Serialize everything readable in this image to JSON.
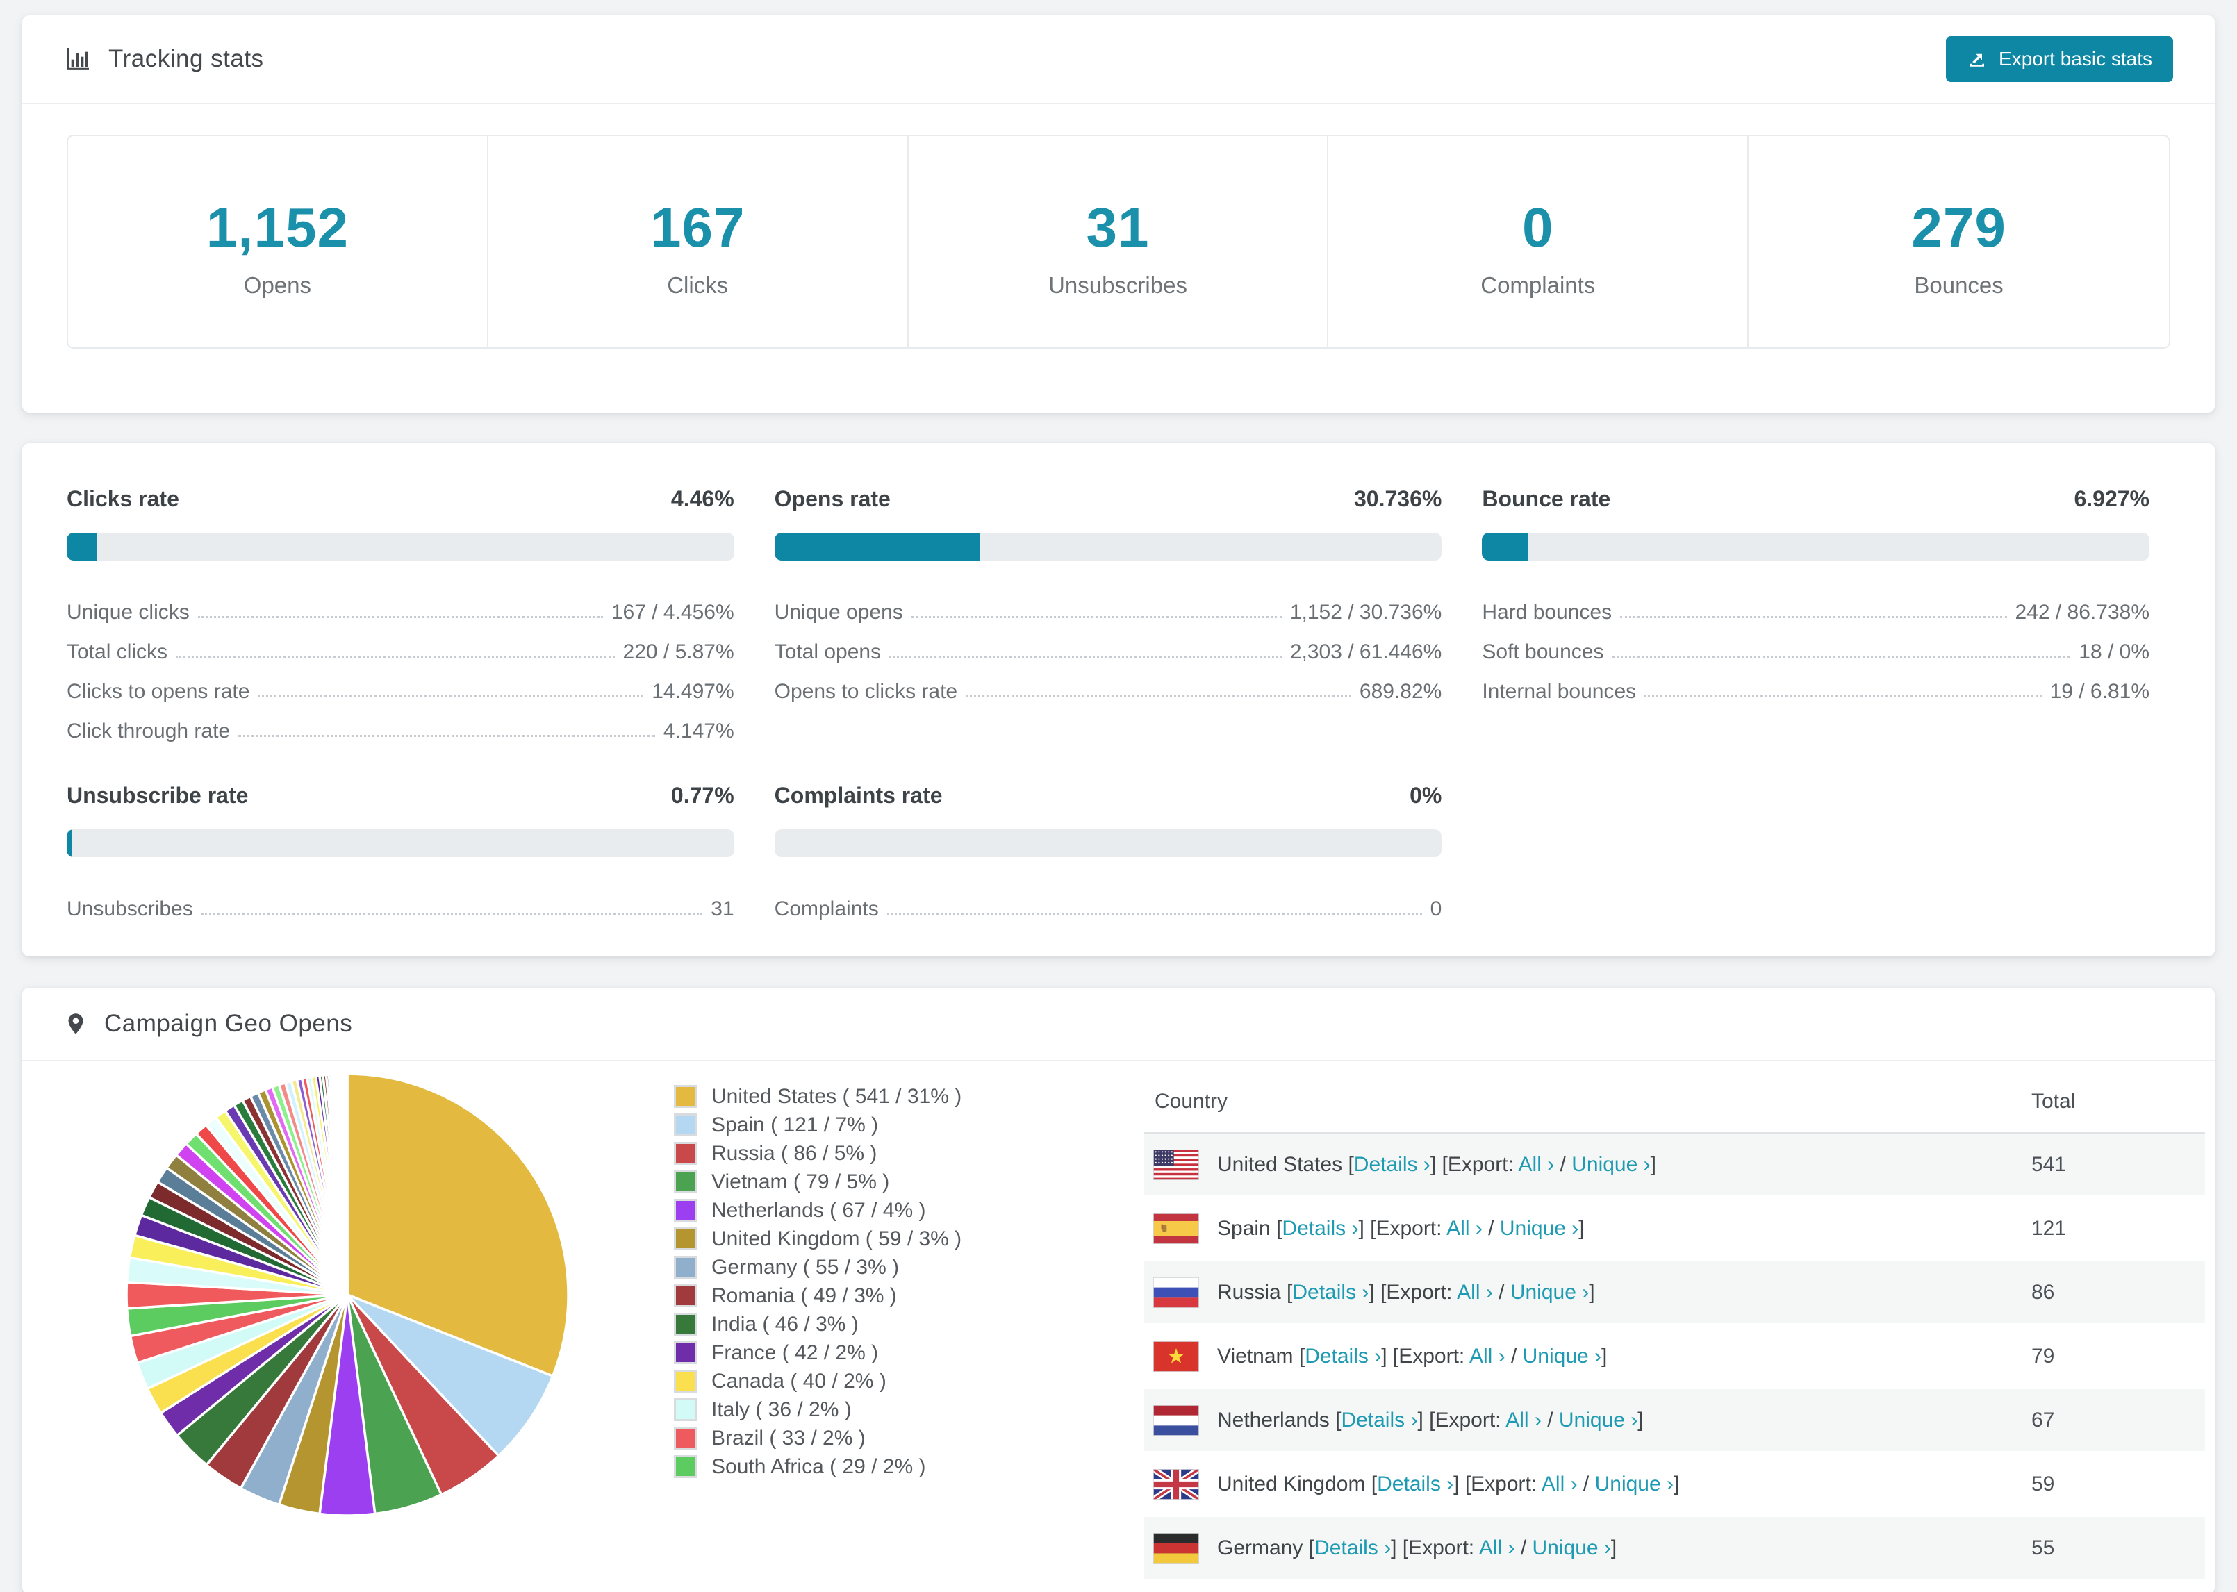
{
  "accent": {
    "teal_number": "#1b90aa",
    "teal_button": "#0d87a3",
    "teal_link": "#1e9ab2",
    "bar_track": "#e9ecef"
  },
  "tracking_card": {
    "title": "Tracking stats",
    "export_button": {
      "label": "Export basic stats"
    },
    "summary": [
      {
        "value": "1,152",
        "label": "Opens"
      },
      {
        "value": "167",
        "label": "Clicks"
      },
      {
        "value": "31",
        "label": "Unsubscribes"
      },
      {
        "value": "0",
        "label": "Complaints"
      },
      {
        "value": "279",
        "label": "Bounces"
      }
    ]
  },
  "rates_card": {
    "blocks": [
      {
        "title": "Clicks rate",
        "value": "4.46%",
        "pct": 4.46,
        "rows": [
          {
            "label": "Unique clicks",
            "value": "167 / 4.456%"
          },
          {
            "label": "Total clicks",
            "value": "220 / 5.87%"
          },
          {
            "label": "Clicks to opens rate",
            "value": "14.497%"
          },
          {
            "label": "Click through rate",
            "value": "4.147%"
          }
        ]
      },
      {
        "title": "Opens rate",
        "value": "30.736%",
        "pct": 30.736,
        "rows": [
          {
            "label": "Unique opens",
            "value": "1,152 / 30.736%"
          },
          {
            "label": "Total opens",
            "value": "2,303 / 61.446%"
          },
          {
            "label": "Opens to clicks rate",
            "value": "689.82%"
          }
        ]
      },
      {
        "title": "Bounce rate",
        "value": "6.927%",
        "pct": 6.927,
        "rows": [
          {
            "label": "Hard bounces",
            "value": "242 / 86.738%"
          },
          {
            "label": "Soft bounces",
            "value": "18 / 0%"
          },
          {
            "label": "Internal bounces",
            "value": "19 / 6.81%"
          }
        ]
      },
      {
        "title": "Unsubscribe rate",
        "value": "0.77%",
        "pct": 0.77,
        "rows": [
          {
            "label": "Unsubscribes",
            "value": "31"
          }
        ]
      },
      {
        "title": "Complaints rate",
        "value": "0%",
        "pct": 0,
        "rows": [
          {
            "label": "Complaints",
            "value": "0"
          }
        ]
      }
    ]
  },
  "geo_card": {
    "title": "Campaign Geo Opens",
    "legend": [
      {
        "label": "United States ( 541 / 31% )",
        "color": "#e3ba3f"
      },
      {
        "label": "Spain ( 121 / 7% )",
        "color": "#b5d8f2"
      },
      {
        "label": "Russia ( 86 / 5% )",
        "color": "#c9494b"
      },
      {
        "label": "Vietnam ( 79 / 5% )",
        "color": "#4ba250"
      },
      {
        "label": "Netherlands ( 67 / 4% )",
        "color": "#9b3ff0"
      },
      {
        "label": "United Kingdom ( 59 / 3% )",
        "color": "#b5952f"
      },
      {
        "label": "Germany ( 55 / 3% )",
        "color": "#8fafcd"
      },
      {
        "label": "Romania ( 49 / 3% )",
        "color": "#a03a3c"
      },
      {
        "label": "India ( 46 / 3% )",
        "color": "#36793a"
      },
      {
        "label": "France ( 42 / 2% )",
        "color": "#6f2daa"
      },
      {
        "label": "Canada ( 40 / 2% )",
        "color": "#fae04e"
      },
      {
        "label": "Italy ( 36 / 2% )",
        "color": "#d2fbf8"
      },
      {
        "label": "Brazil ( 33 / 2% )",
        "color": "#ef5a5e"
      },
      {
        "label": "South Africa ( 29 / 2% )",
        "color": "#5dcc60"
      }
    ],
    "table": {
      "columns": [
        "Country",
        "Total"
      ],
      "tokens": {
        "open": "[",
        "close": "]",
        "export": "Export:",
        "slash": "/",
        "details": "Details ›",
        "all": "All ›",
        "unique": "Unique ›"
      },
      "rows": [
        {
          "country": "United States",
          "flag": "us",
          "total": "541"
        },
        {
          "country": "Spain",
          "flag": "es",
          "total": "121"
        },
        {
          "country": "Russia",
          "flag": "ru",
          "total": "86"
        },
        {
          "country": "Vietnam",
          "flag": "vn",
          "total": "79"
        },
        {
          "country": "Netherlands",
          "flag": "nl",
          "total": "67"
        },
        {
          "country": "United Kingdom",
          "flag": "gb",
          "total": "59"
        },
        {
          "country": "Germany",
          "flag": "de",
          "total": "55"
        }
      ]
    }
  },
  "chart_data": {
    "type": "pie",
    "title": "Campaign Geo Opens",
    "labels": [
      "United States",
      "Spain",
      "Russia",
      "Vietnam",
      "Netherlands",
      "United Kingdom",
      "Germany",
      "Romania",
      "India",
      "France",
      "Canada",
      "Italy",
      "Brazil",
      "South Africa"
    ],
    "values": [
      541,
      121,
      86,
      79,
      67,
      59,
      55,
      49,
      46,
      42,
      40,
      36,
      33,
      29
    ],
    "percents": [
      31,
      7,
      5,
      5,
      4,
      3,
      3,
      3,
      3,
      2,
      2,
      2,
      2,
      2
    ],
    "colors": [
      "#e3ba3f",
      "#b5d8f2",
      "#c9494b",
      "#4ba250",
      "#9b3ff0",
      "#b5952f",
      "#8fafcd",
      "#a03a3c",
      "#36793a",
      "#6f2daa",
      "#fae04e",
      "#d2fbf8",
      "#ef5a5e",
      "#5dcc60"
    ],
    "start_angle_deg": -90,
    "direction": "clockwise",
    "legend_position": "right",
    "other_slices_pct": [
      1.9,
      1.78,
      1.65,
      1.53,
      1.4,
      1.27,
      1.21,
      1.15,
      1.08,
      1.02,
      0.95,
      0.89,
      0.83,
      0.76,
      0.7,
      0.64,
      0.61,
      0.57,
      0.53,
      0.51,
      0.48,
      0.45,
      0.41,
      0.38,
      0.36,
      0.33,
      0.31,
      0.28,
      0.25,
      0.23,
      0.2,
      0.18,
      0.17,
      0.15,
      0.14,
      0.13,
      0.11,
      0.1,
      0.09,
      0.08,
      0.06,
      0.05,
      0.04,
      0.03
    ],
    "extra_palette": [
      "#f05a5c",
      "#d9fcfa",
      "#f8ef5a",
      "#5c2a9e",
      "#226a34",
      "#7c2a2c",
      "#5b7e98",
      "#90803f",
      "#d043f0",
      "#6fe06f",
      "#ef4848",
      "#ecfffe",
      "#f6f66c",
      "#6a3ab2",
      "#2a7c3c",
      "#8c3232",
      "#6a8aaa",
      "#ab9232",
      "#e06af2",
      "#8cf08c",
      "#f28c8c",
      "#d2f2ff",
      "#f2ea8c",
      "#8c5cd2"
    ]
  }
}
